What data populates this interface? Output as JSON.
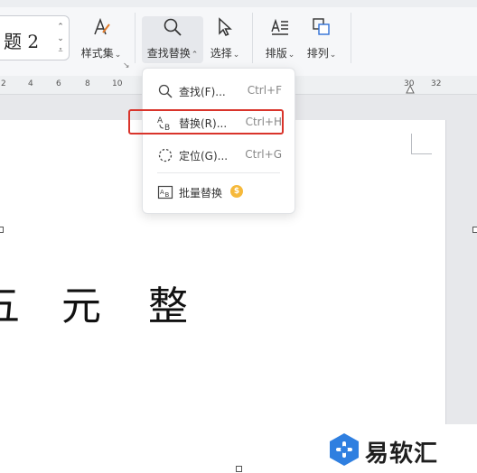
{
  "toolbar": {
    "style_box": {
      "text": "题 2",
      "spin_up": "⌃",
      "spin_down": "⌄",
      "more": "⩡"
    },
    "style_set_label": "样式集",
    "find_replace_label": "查找替换",
    "select_label": "选择",
    "layout_label": "排版",
    "arrange_label": "排列",
    "dropdown_caret": "⌄",
    "active_caret": "⌃"
  },
  "ruler": {
    "ticks": [
      "2",
      "4",
      "6",
      "8",
      "10",
      "30",
      "32"
    ]
  },
  "menu": {
    "items": [
      {
        "label": "查找(F)...",
        "shortcut": "Ctrl+F"
      },
      {
        "label": "替换(R)...",
        "shortcut": "Ctrl+H"
      },
      {
        "label": "定位(G)...",
        "shortcut": "Ctrl+G"
      },
      {
        "label": "批量替换",
        "shortcut": ""
      }
    ]
  },
  "document": {
    "chars": [
      "五",
      "元",
      "整"
    ]
  },
  "watermark": {
    "text": "易软汇"
  },
  "colors": {
    "highlight": "#d9342b",
    "accent": "#2f6fd6",
    "coin": "#f6b93b"
  }
}
